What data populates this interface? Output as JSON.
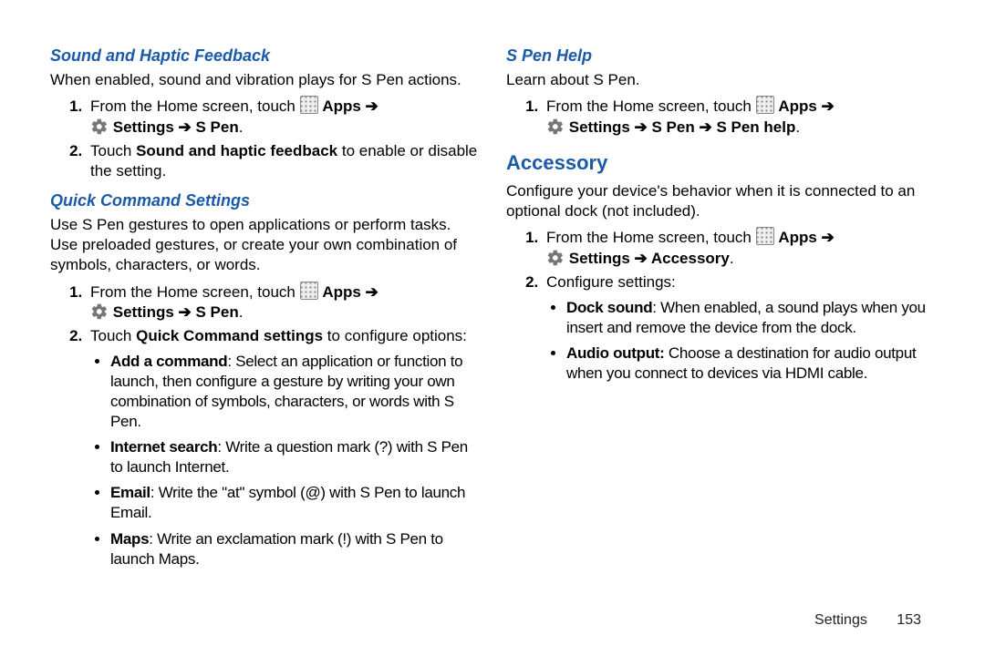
{
  "left": {
    "h_sound": "Sound and Haptic Feedback",
    "sound_intro": "When enabled, sound and vibration plays for S Pen actions.",
    "from_home": "From the Home screen, touch ",
    "apps_bold": "Apps",
    "arrow": " ➔ ",
    "settings_bold": "Settings",
    "spen_bold": "S Pen",
    "period": ".",
    "sound_step2_a": "Touch ",
    "sound_step2_b": "Sound and haptic feedback",
    "sound_step2_c": " to enable or disable the setting.",
    "h_quick": "Quick Command Settings",
    "quick_intro": "Use S Pen gestures to open applications or perform tasks. Use preloaded gestures, or create your own combination of symbols, characters, or words.",
    "quick_step2_a": "Touch ",
    "quick_step2_b": "Quick Command settings",
    "quick_step2_c": " to configure options:",
    "b_addcmd_t": "Add a command",
    "b_addcmd_d": ": Select an application or function to launch, then configure a gesture by writing your own combination of symbols, characters, or words with S Pen.",
    "b_net_t": "Internet search",
    "b_net_d": ": Write a question mark (?) with S Pen to launch Internet.",
    "b_email_t": "Email",
    "b_email_d": ": Write the \"at\" symbol (@) with S Pen to launch Email.",
    "b_maps_t": "Maps",
    "b_maps_d": ": Write an exclamation mark (!) with S Pen to launch Maps."
  },
  "right": {
    "h_spenhelp": "S Pen Help",
    "spenhelp_intro": "Learn about S Pen.",
    "spenhelp_path_tail": "S Pen help",
    "h_accessory": "Accessory",
    "accessory_intro": "Configure your device's behavior when it is connected to an optional dock (not included).",
    "accessory_bold": "Accessory",
    "configure": "Configure settings:",
    "b_dock_t": "Dock sound",
    "b_dock_d": ": When enabled, a sound plays when you insert and remove the device from the dock.",
    "b_audio_t": "Audio output:",
    "b_audio_d": " Choose a destination for audio output when you connect to devices via HDMI cable."
  },
  "footer": {
    "section": "Settings",
    "page": "153"
  }
}
